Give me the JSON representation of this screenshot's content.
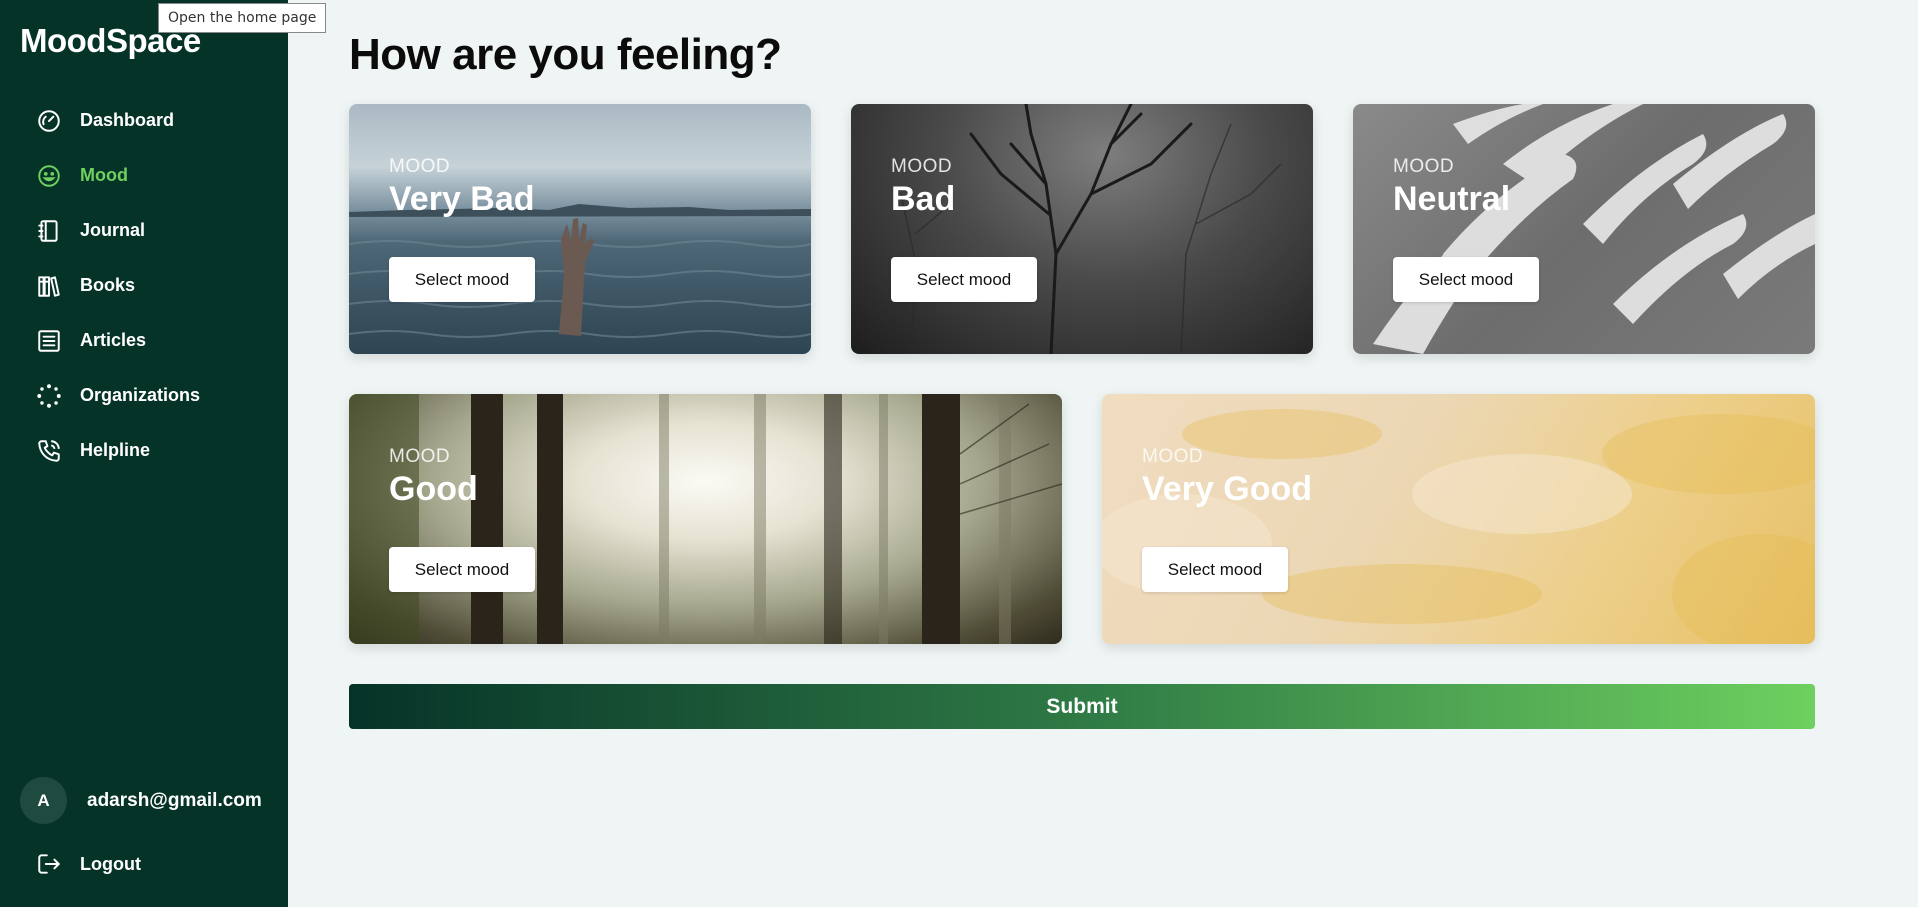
{
  "app": {
    "name": "MoodSpace"
  },
  "tooltip": "Open the home page",
  "sidebar": {
    "items": [
      {
        "label": "Dashboard",
        "icon": "dashboard-gauge-icon",
        "active": false
      },
      {
        "label": "Mood",
        "icon": "smiley-face-icon",
        "active": true
      },
      {
        "label": "Journal",
        "icon": "journal-notebook-icon",
        "active": false
      },
      {
        "label": "Books",
        "icon": "books-icon",
        "active": false
      },
      {
        "label": "Articles",
        "icon": "articles-list-icon",
        "active": false
      },
      {
        "label": "Organizations",
        "icon": "dots-grid-icon",
        "active": false
      },
      {
        "label": "Helpline",
        "icon": "phone-icon",
        "active": false
      }
    ],
    "user": {
      "initial": "A",
      "email": "adarsh@gmail.com"
    },
    "logout_label": "Logout"
  },
  "main": {
    "title": "How are you feeling?",
    "cards": [
      {
        "eyebrow": "MOOD",
        "title": "Very Bad",
        "button": "Select mood"
      },
      {
        "eyebrow": "MOOD",
        "title": "Bad",
        "button": "Select mood"
      },
      {
        "eyebrow": "MOOD",
        "title": "Neutral",
        "button": "Select mood"
      },
      {
        "eyebrow": "MOOD",
        "title": "Good",
        "button": "Select mood"
      },
      {
        "eyebrow": "MOOD",
        "title": "Very Good",
        "button": "Select mood"
      }
    ],
    "submit_label": "Submit"
  },
  "colors": {
    "sidebar_bg": "#063328",
    "active_nav": "#6ed05f",
    "page_bg": "#eff5f4",
    "submit_gradient_start": "#063328",
    "submit_gradient_end": "#6ed05f"
  }
}
